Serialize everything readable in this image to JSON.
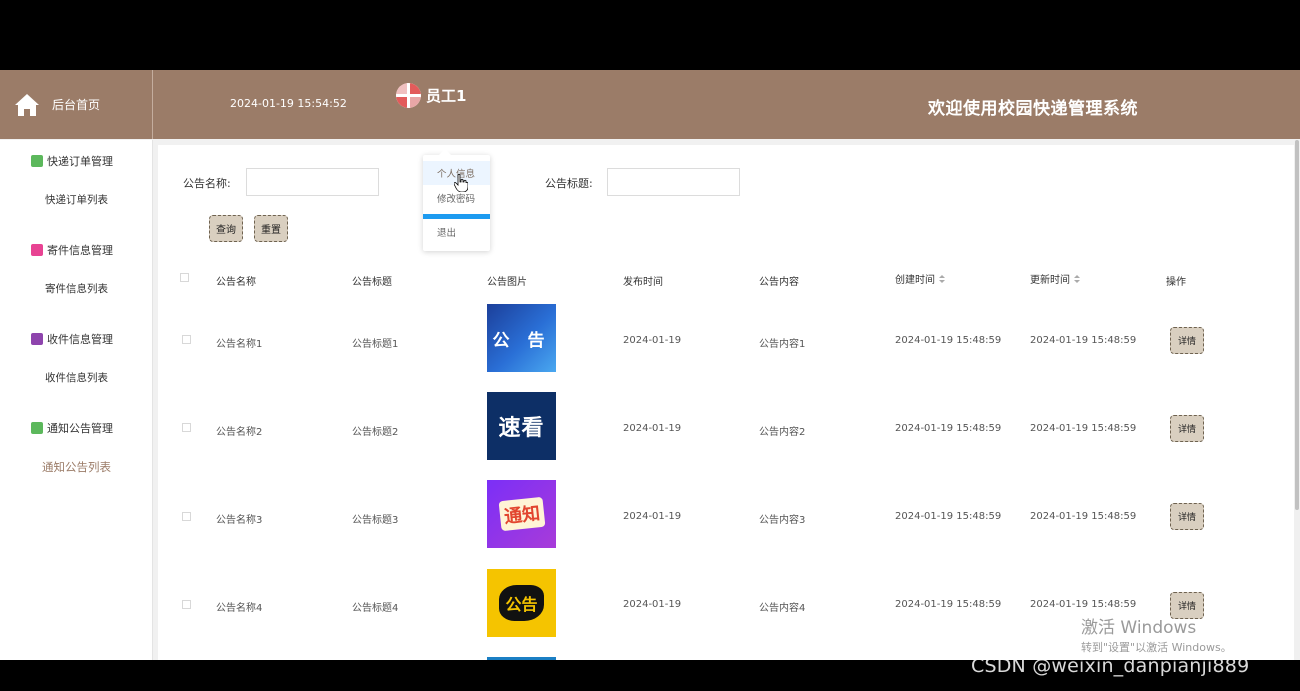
{
  "header": {
    "home_label": "后台首页",
    "datetime": "2024-01-19 15:54:52",
    "username": "员工1",
    "welcome": "欢迎使用校园快递管理系统"
  },
  "user_menu": {
    "items": [
      {
        "label": "个人信息"
      },
      {
        "label": "修改密码"
      },
      {
        "label": "退出"
      }
    ]
  },
  "sidebar": {
    "groups": [
      {
        "title": "快递订单管理",
        "icon": "chat-bubble-icon",
        "color": "#5cb85c",
        "sub": "快递订单列表"
      },
      {
        "title": "寄件信息管理",
        "icon": "gift-icon",
        "color": "#e84393",
        "sub": "寄件信息列表"
      },
      {
        "title": "收件信息管理",
        "icon": "archive-icon",
        "color": "#8e44ad",
        "sub": "收件信息列表"
      },
      {
        "title": "通知公告管理",
        "icon": "chat-bubble-icon",
        "color": "#5cb85c",
        "sub": "通知公告列表"
      }
    ]
  },
  "search": {
    "name_label": "公告名称:",
    "name_value": "",
    "title_label": "公告标题:",
    "title_value": "",
    "query_button": "查询",
    "reset_button": "重置"
  },
  "table": {
    "headers": {
      "name": "公告名称",
      "title": "公告标题",
      "image": "公告图片",
      "publish_time": "发布时间",
      "content": "公告内容",
      "created": "创建时间",
      "updated": "更新时间",
      "action": "操作"
    },
    "rows": [
      {
        "name": "公告名称1",
        "title": "公告标题1",
        "image_text": "公 告",
        "publish_time": "2024-01-19",
        "content": "公告内容1",
        "created": "2024-01-19 15:48:59",
        "updated": "2024-01-19 15:48:59",
        "action": "详情"
      },
      {
        "name": "公告名称2",
        "title": "公告标题2",
        "image_text": "速看",
        "publish_time": "2024-01-19",
        "content": "公告内容2",
        "created": "2024-01-19 15:48:59",
        "updated": "2024-01-19 15:48:59",
        "action": "详情"
      },
      {
        "name": "公告名称3",
        "title": "公告标题3",
        "image_text": "通知",
        "publish_time": "2024-01-19",
        "content": "公告内容3",
        "created": "2024-01-19 15:48:59",
        "updated": "2024-01-19 15:48:59",
        "action": "详情"
      },
      {
        "name": "公告名称4",
        "title": "公告标题4",
        "image_text": "公告",
        "publish_time": "2024-01-19",
        "content": "公告内容4",
        "created": "2024-01-19 15:48:59",
        "updated": "2024-01-19 15:48:59",
        "action": "详情"
      }
    ]
  },
  "overlay": {
    "watermark_line1": "激活 Windows",
    "watermark_line2": "转到\"设置\"以激活 Windows。",
    "csdn": "CSDN @weixin_danpianji889"
  },
  "colors": {
    "header_bg": "#9b7c68",
    "button_bg": "#d9cfc0",
    "active_menu": "#9b7c68"
  }
}
